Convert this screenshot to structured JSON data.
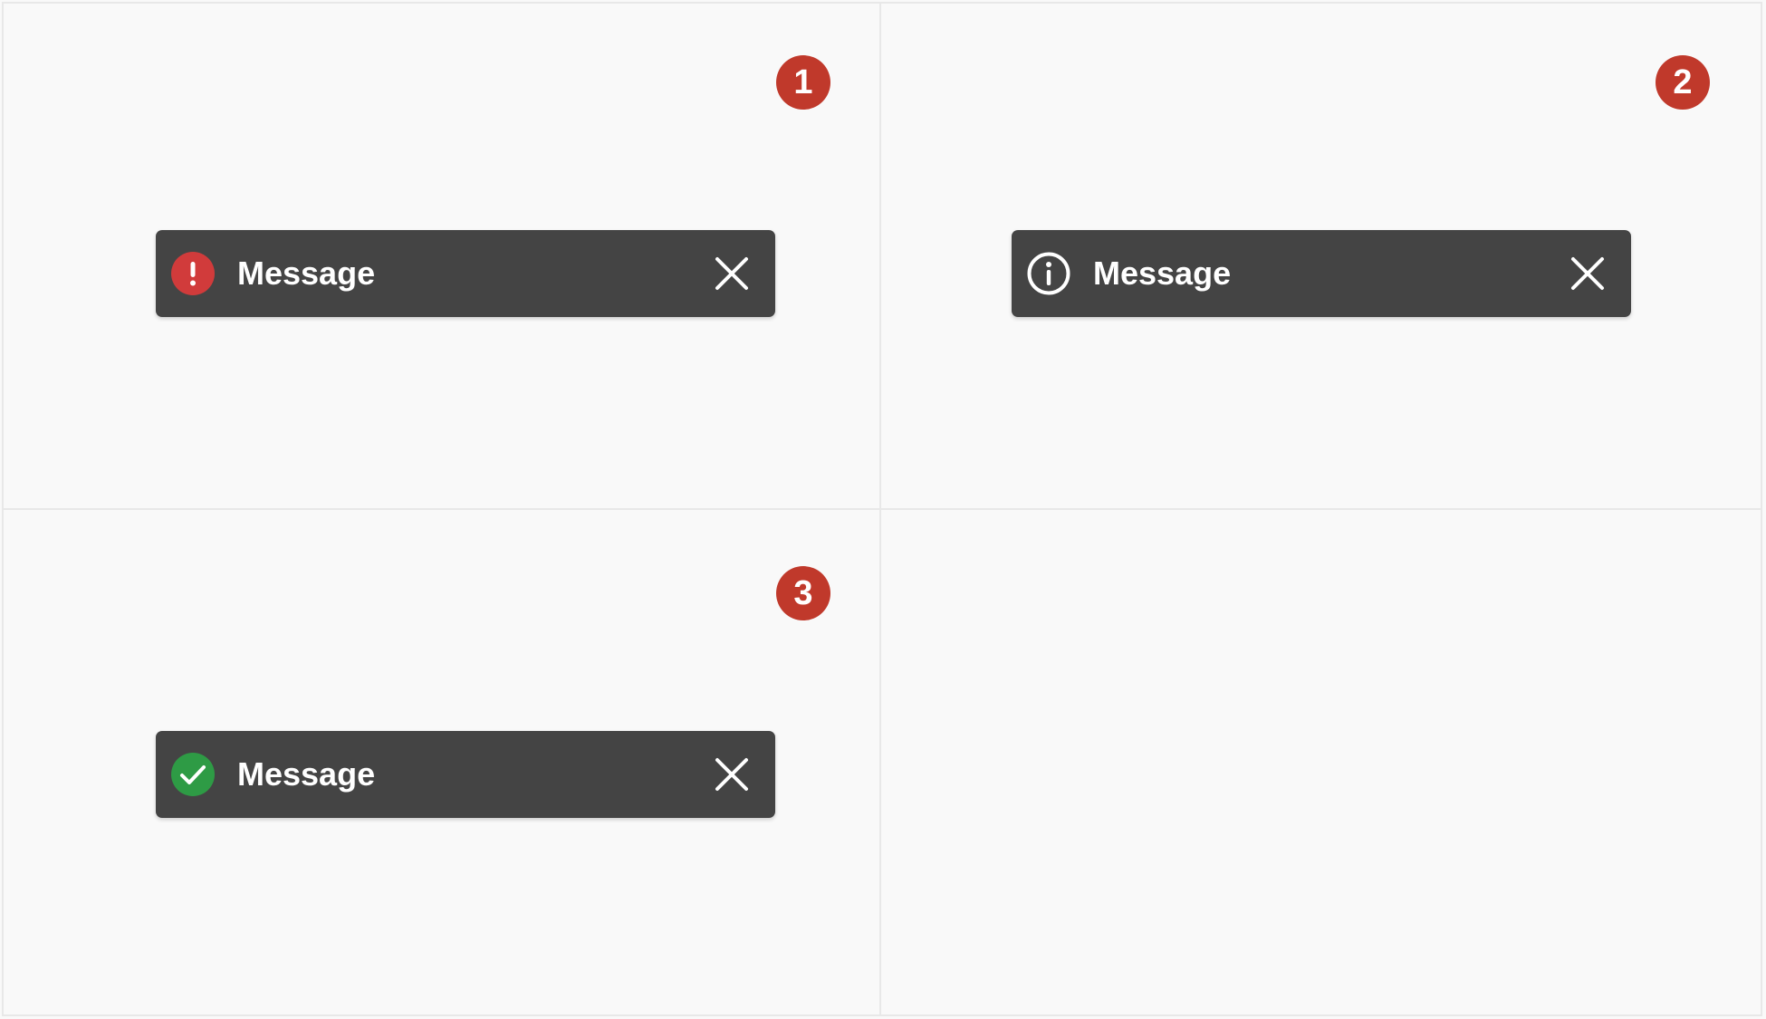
{
  "colors": {
    "background": "#f9f9f9",
    "toast_background": "#444444",
    "marker": "#c0392b",
    "error_icon": "#d13b3b",
    "success_icon": "#2e9b45",
    "text": "#ffffff"
  },
  "panels": [
    {
      "marker": "1",
      "toast": {
        "type": "error",
        "icon": "error-icon",
        "message": "Message",
        "close_icon": "close-icon"
      }
    },
    {
      "marker": "2",
      "toast": {
        "type": "info",
        "icon": "info-icon",
        "message": "Message",
        "close_icon": "close-icon"
      }
    },
    {
      "marker": "3",
      "toast": {
        "type": "success",
        "icon": "success-icon",
        "message": "Message",
        "close_icon": "close-icon"
      }
    }
  ]
}
